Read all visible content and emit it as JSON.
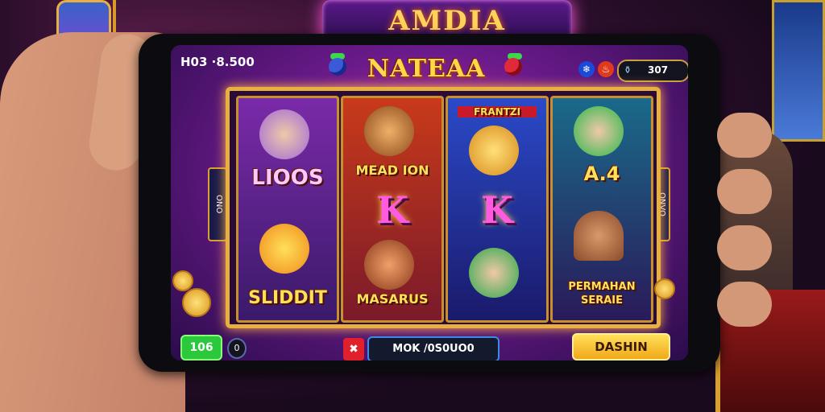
{
  "background": {
    "sign_text": "AMDIA"
  },
  "topbar": {
    "balance": "H03 ·8.500",
    "logo": "NATEAA",
    "gem_icon": "gem-icon",
    "fire_icon": "fire-icon",
    "coin_value": "307",
    "coin_icon": "bottle-icon"
  },
  "reels": [
    {
      "top_label": "LIOOS",
      "top_badge": "",
      "bottom_label": "SLIDDIT"
    },
    {
      "top_label": "MEAD ION",
      "middle_symbol": "K",
      "bottom_label": "MASARUS"
    },
    {
      "top_label": "",
      "top_badge": "FRANTZI",
      "middle_symbol": "K"
    },
    {
      "top_label": "A.4",
      "bottom_label": "PERMAHAN SERAIE"
    }
  ],
  "side_tabs": {
    "left": "ONO",
    "right": "ONVO"
  },
  "bottom": {
    "green_button": "106",
    "zero_button": "0",
    "red_icon": "x-icon",
    "message": "MOK /0S0UO0",
    "yellow_button": "DASHIN"
  },
  "colors": {
    "accent_gold": "#e8b040",
    "green": "#2ac83a",
    "yellow": "#ffd94a",
    "red": "#e0202a"
  }
}
